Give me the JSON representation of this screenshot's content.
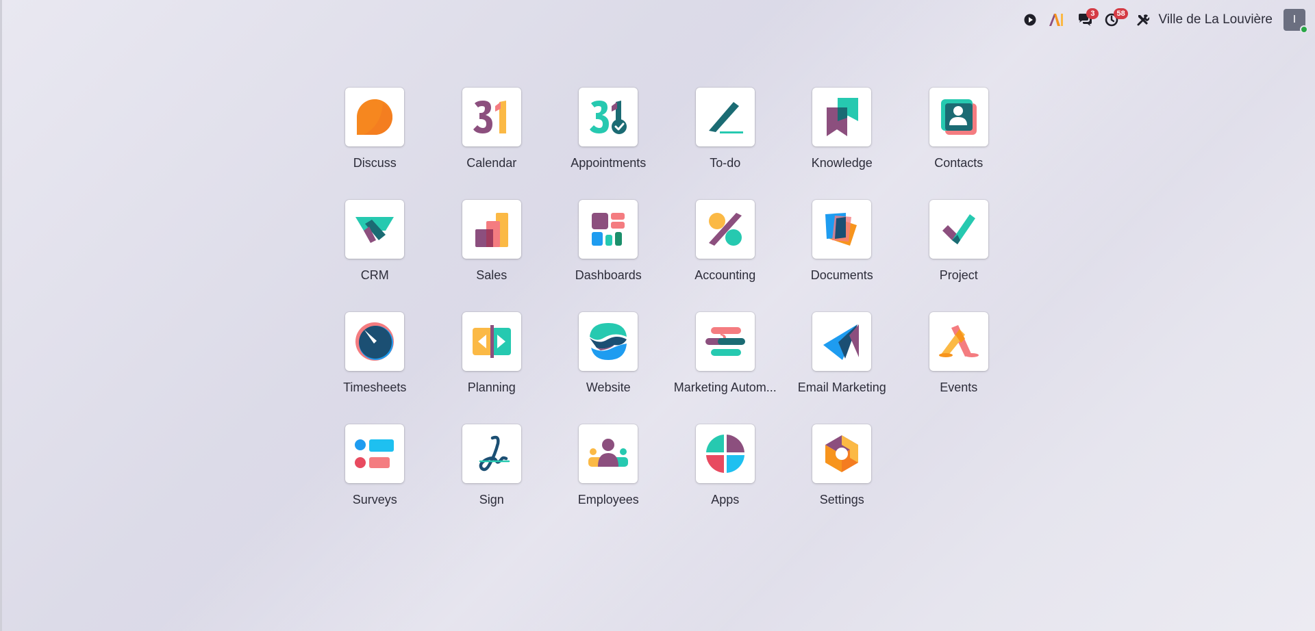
{
  "topbar": {
    "company_name": "Ville de La Louvière",
    "messages_count": "3",
    "activities_count": "58",
    "avatar_initial": "I",
    "icons": [
      "play-icon",
      "ai-icon",
      "chat-icon",
      "clock-icon",
      "tools-icon"
    ]
  },
  "apps": [
    {
      "label": "Discuss",
      "icon": "discuss-icon"
    },
    {
      "label": "Calendar",
      "icon": "calendar-icon"
    },
    {
      "label": "Appointments",
      "icon": "appointments-icon"
    },
    {
      "label": "To-do",
      "icon": "todo-icon"
    },
    {
      "label": "Knowledge",
      "icon": "knowledge-icon"
    },
    {
      "label": "Contacts",
      "icon": "contacts-icon"
    },
    {
      "label": "CRM",
      "icon": "crm-icon"
    },
    {
      "label": "Sales",
      "icon": "sales-icon"
    },
    {
      "label": "Dashboards",
      "icon": "dashboards-icon"
    },
    {
      "label": "Accounting",
      "icon": "accounting-icon"
    },
    {
      "label": "Documents",
      "icon": "documents-icon"
    },
    {
      "label": "Project",
      "icon": "project-icon"
    },
    {
      "label": "Timesheets",
      "icon": "timesheets-icon"
    },
    {
      "label": "Planning",
      "icon": "planning-icon"
    },
    {
      "label": "Website",
      "icon": "website-icon"
    },
    {
      "label": "Marketing Autom...",
      "icon": "marketing-automation-icon"
    },
    {
      "label": "Email Marketing",
      "icon": "email-marketing-icon"
    },
    {
      "label": "Events",
      "icon": "events-icon"
    },
    {
      "label": "Surveys",
      "icon": "surveys-icon"
    },
    {
      "label": "Sign",
      "icon": "sign-icon"
    },
    {
      "label": "Employees",
      "icon": "employees-icon"
    },
    {
      "label": "Apps",
      "icon": "apps-icon"
    },
    {
      "label": "Settings",
      "icon": "settings-icon"
    }
  ],
  "colors": {
    "purple": "#8c4f7e",
    "teal": "#26c9b0",
    "dark_teal": "#1b6b73",
    "orange": "#f7941d",
    "yellow": "#fbb945",
    "pink": "#f47c80",
    "blue": "#1e9cf0",
    "badge_red": "#d43b44"
  }
}
